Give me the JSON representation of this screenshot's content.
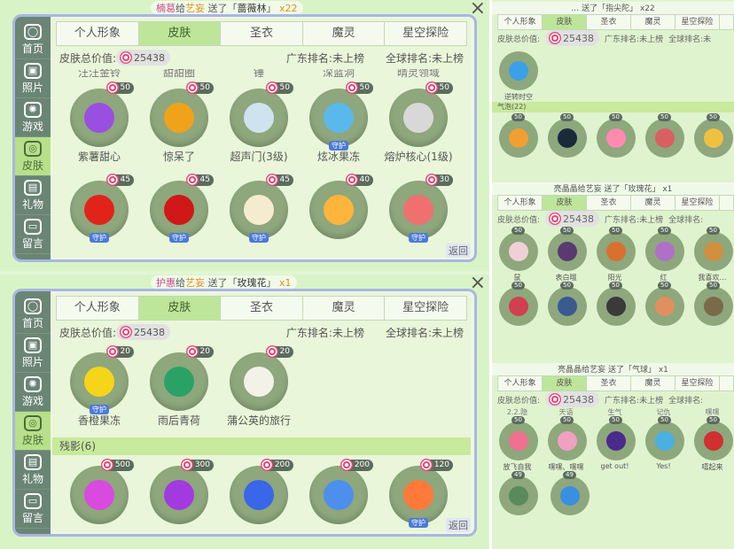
{
  "panelA": {
    "ticker": {
      "sender": "楠葛",
      "mid": "给",
      "receiver": "艺妄",
      "action": "送了「",
      "gift": "蔷薇林",
      "end": "」",
      "count": "x22"
    },
    "close_icon": "×",
    "sidebar": [
      {
        "label": "首页",
        "icon": "home-icon",
        "glyph": "◯"
      },
      {
        "label": "照片",
        "icon": "photo-icon",
        "glyph": "▣"
      },
      {
        "label": "游戏",
        "icon": "atom-icon",
        "glyph": "✺"
      },
      {
        "label": "皮肤",
        "icon": "skin-icon",
        "glyph": "◎"
      },
      {
        "label": "礼物",
        "icon": "gift-icon",
        "glyph": "▤"
      },
      {
        "label": "留言",
        "icon": "message-icon",
        "glyph": "▭"
      }
    ],
    "tabs": [
      "个人形象",
      "皮肤",
      "圣衣",
      "魔灵",
      "星空探险"
    ],
    "stats": {
      "label": "皮肤总价值:",
      "value": "25438",
      "rank1": "广东排名:未上榜",
      "rank2": "全球排名:未上榜"
    },
    "clipped_labels": [
      "汪汪金铃",
      "甜甜圈",
      "锤",
      "深蓝洞",
      "晴灵领域"
    ],
    "rows": [
      [
        {
          "name": "紫薯甜心",
          "price": "50",
          "color": "#9b4fe0",
          "guard": ""
        },
        {
          "name": "惊呆了",
          "price": "50",
          "color": "#f0a21a",
          "guard": ""
        },
        {
          "name": "超声门(3级)",
          "price": "50",
          "color": "#cfe3ee",
          "guard": ""
        },
        {
          "name": "炫冰果冻",
          "price": "50",
          "color": "#5bb8ec",
          "guard": "守护"
        },
        {
          "name": "熔炉核心(1级)",
          "price": "50",
          "color": "#d8d8d8",
          "guard": ""
        }
      ],
      [
        {
          "name": "",
          "price": "45",
          "color": "#e2231a",
          "guard": "守护"
        },
        {
          "name": "",
          "price": "45",
          "color": "#d01818",
          "guard": "守护"
        },
        {
          "name": "",
          "price": "45",
          "color": "#f5ecd0",
          "guard": "守护"
        },
        {
          "name": "",
          "price": "40",
          "color": "#ffb43c",
          "guard": ""
        },
        {
          "name": "",
          "price": "30",
          "color": "#f07070",
          "guard": "守护"
        }
      ]
    ],
    "back": "返回"
  },
  "panelB": {
    "ticker": {
      "sender": "护惠",
      "mid": "给",
      "receiver": "艺妄",
      "action": "送了「",
      "gift": "玫瑰花",
      "end": "」",
      "count": "x1"
    },
    "close_icon": "×",
    "sidebar": [
      {
        "label": "首页",
        "icon": "home-icon",
        "glyph": "◯"
      },
      {
        "label": "照片",
        "icon": "photo-icon",
        "glyph": "▣"
      },
      {
        "label": "游戏",
        "icon": "atom-icon",
        "glyph": "✺"
      },
      {
        "label": "皮肤",
        "icon": "skin-icon",
        "glyph": "◎"
      },
      {
        "label": "礼物",
        "icon": "gift-icon",
        "glyph": "▤"
      },
      {
        "label": "留言",
        "icon": "message-icon",
        "glyph": "▭"
      }
    ],
    "tabs": [
      "个人形象",
      "皮肤",
      "圣衣",
      "魔灵",
      "星空探险"
    ],
    "stats": {
      "label": "皮肤总价值:",
      "value": "25438",
      "rank1": "广东排名:未上榜",
      "rank2": "全球排名:未上榜"
    },
    "row1": [
      {
        "name": "香橙果冻",
        "price": "20",
        "color": "#f5d51a",
        "guard": "守护"
      },
      {
        "name": "雨后青荷",
        "price": "20",
        "color": "#2aa266",
        "guard": ""
      },
      {
        "name": "蒲公英的旅行",
        "price": "20",
        "color": "#f2f2e8",
        "guard": ""
      }
    ],
    "section": "残影(6)",
    "row2": [
      {
        "name": "",
        "price": "500",
        "color": "#d84ae0",
        "guard": ""
      },
      {
        "name": "",
        "price": "300",
        "color": "#a23ae0",
        "guard": ""
      },
      {
        "name": "",
        "price": "200",
        "color": "#3a66e8",
        "guard": ""
      },
      {
        "name": "",
        "price": "200",
        "color": "#4d8fec",
        "guard": ""
      },
      {
        "name": "",
        "price": "120",
        "color": "#ff7a3a",
        "guard": "守护"
      }
    ],
    "back": "返回"
  },
  "right1": {
    "ticker": "… 送了「指尖陀」 x22",
    "tabs": [
      "个人形象",
      "皮肤",
      "圣衣",
      "魔灵",
      "星空探险"
    ],
    "stat": "皮肤总价值:",
    "value": "25438",
    "rank1": "广东排名:未上榜",
    "rank2": "全球排名:未",
    "toprow": [
      {
        "name": "逆转时空",
        "price": "",
        "color": "#3aa0e8"
      }
    ],
    "section": "气泡(22)",
    "row": [
      {
        "name": "",
        "price": "50",
        "color": "#f0a030"
      },
      {
        "name": "",
        "price": "50",
        "color": "#1a2a3a"
      },
      {
        "name": "",
        "price": "50",
        "color": "#ff8ab0"
      },
      {
        "name": "",
        "price": "50",
        "color": "#d86060"
      },
      {
        "name": "",
        "price": "50",
        "color": "#f0c040"
      }
    ]
  },
  "right2": {
    "ticker": "亮晶晶给艺妄 送了「玫瑰花」 x1",
    "tabs": [
      "个人形象",
      "皮肤",
      "圣衣",
      "魔灵",
      "星空探险"
    ],
    "stat": "皮肤总价值:",
    "value": "25438",
    "rank1": "广东排名:未上榜",
    "rank2": "全球排名:",
    "row1": [
      {
        "name": "鼠",
        "price": "50",
        "color": "#f0d0d8"
      },
      {
        "name": "表白哦",
        "price": "50",
        "color": "#5a3a70"
      },
      {
        "name": "阳光",
        "price": "50",
        "color": "#d87030"
      },
      {
        "name": "红",
        "price": "50",
        "color": "#b070c8"
      },
      {
        "name": "我喜欢…",
        "price": "50",
        "color": "#d09040"
      }
    ],
    "row2": [
      {
        "name": "",
        "price": "50",
        "color": "#d04050"
      },
      {
        "name": "",
        "price": "50",
        "color": "#3a5a90"
      },
      {
        "name": "",
        "price": "50",
        "color": "#3a3a3a"
      },
      {
        "name": "",
        "price": "50",
        "color": "#e09060"
      },
      {
        "name": "",
        "price": "50",
        "color": "#7a6a4a"
      }
    ]
  },
  "right3": {
    "ticker": "亮晶晶给艺妄 送了「气球」 x1",
    "tabs": [
      "个人形象",
      "皮肤",
      "圣衣",
      "魔灵",
      "星空探险"
    ],
    "stat": "皮肤总价值:",
    "value": "25438",
    "rank1": "广东排名:未上榜",
    "rank2": "全球排名:",
    "cliplabels": [
      "2.2.隐",
      "天语",
      "生气",
      "记仇",
      "嘿嘿"
    ],
    "row1": [
      {
        "name": "放飞自我",
        "price": "50",
        "color": "#f07090"
      },
      {
        "name": "嘿嘿、嘿嘿",
        "price": "50",
        "color": "#f0a0c0"
      },
      {
        "name": "get out!",
        "price": "50",
        "color": "#4a2a8a"
      },
      {
        "name": "Yes!",
        "price": "50",
        "color": "#4ab0e0"
      },
      {
        "name": "嘻起来",
        "price": "50",
        "color": "#d03030"
      }
    ],
    "row2": [
      {
        "name": "",
        "price": "49",
        "color": "#5a8a5a"
      },
      {
        "name": "",
        "price": "49",
        "color": "#3a90e0"
      }
    ]
  }
}
